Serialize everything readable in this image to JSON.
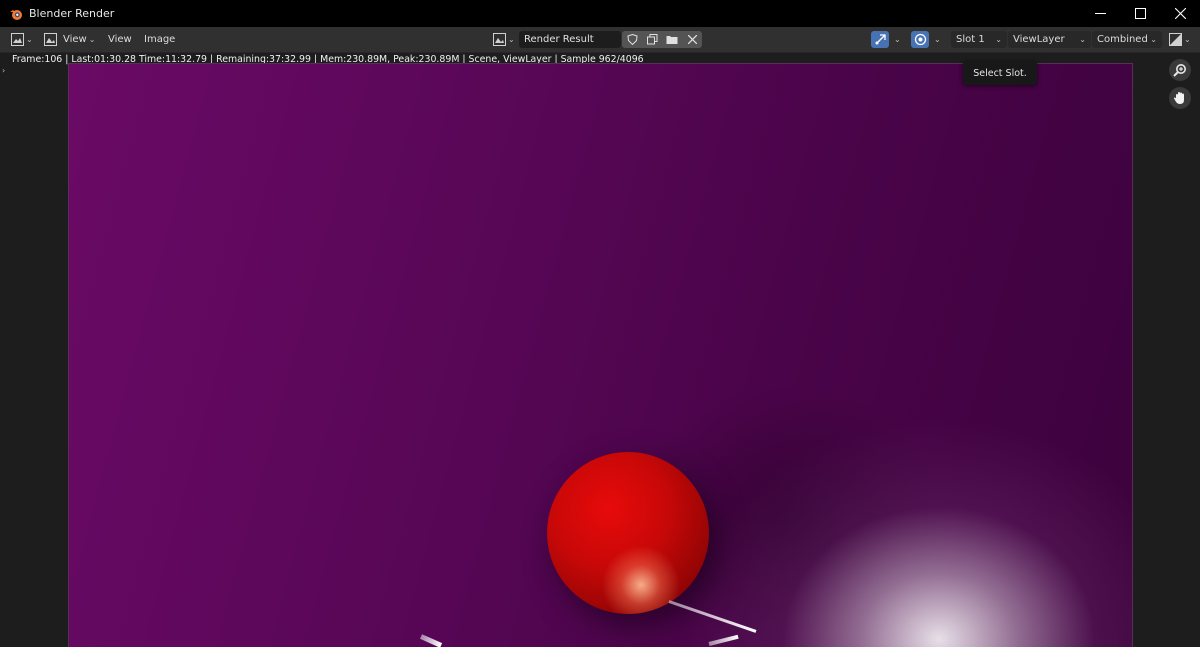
{
  "window": {
    "title": "Blender Render",
    "controls": [
      "minimize",
      "maximize",
      "close"
    ]
  },
  "header": {
    "editor_type_icon": "image-editor-icon",
    "view_menu": "View",
    "menus": [
      "View",
      "Image"
    ],
    "image_name": "Render Result",
    "slot": "Slot 1",
    "view_layer": "ViewLayer",
    "pass": "Combined"
  },
  "status_line": "Frame:106 | Last:01:30.28 Time:11:32.79 | Remaining:37:32.99 | Mem:230.89M, Peak:230.89M | Scene, ViewLayer | Sample 962/4096",
  "tooltip": "Select Slot.",
  "colors": {
    "accent": "#4772b3",
    "background": "#1d1d1d",
    "header": "#303030",
    "render_bg": "#5a0758",
    "sphere": "#c80808"
  }
}
